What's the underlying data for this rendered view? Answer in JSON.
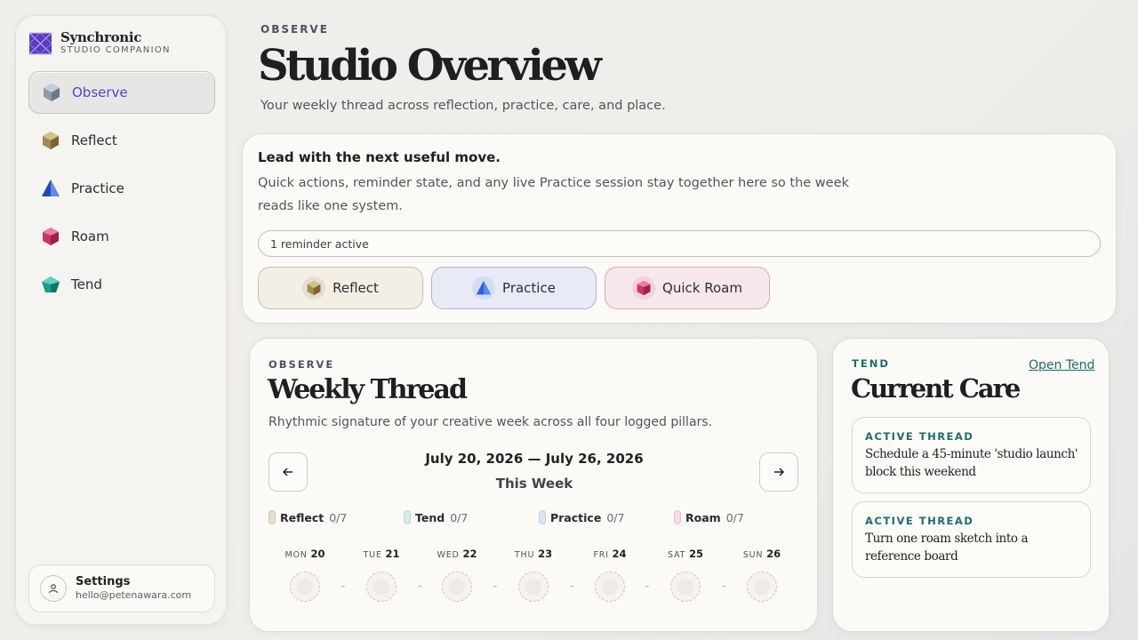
{
  "brand": {
    "name": "Synchronic",
    "subtitle": "STUDIO COMPANION"
  },
  "sidebar": {
    "items": [
      {
        "label": "Observe",
        "icon": "observe-gem-icon",
        "active": true
      },
      {
        "label": "Reflect",
        "icon": "reflect-gem-icon"
      },
      {
        "label": "Practice",
        "icon": "practice-gem-icon"
      },
      {
        "label": "Roam",
        "icon": "roam-gem-icon"
      },
      {
        "label": "Tend",
        "icon": "tend-gem-icon"
      }
    ],
    "settings": {
      "title": "Settings",
      "email": "hello@petenawara.com",
      "icon": "user-icon"
    }
  },
  "header": {
    "eyebrow": "OBSERVE",
    "title": "Studio Overview",
    "subtitle": "Your weekly thread across reflection, practice, care, and place."
  },
  "actions": {
    "title": "Lead with the next useful move.",
    "description": "Quick actions, reminder state, and any live Practice session stay together here so the week reads like one system.",
    "reminder": "1 reminder active",
    "buttons": {
      "reflect": "Reflect",
      "practice": "Practice",
      "roam": "Quick Roam"
    }
  },
  "weekly": {
    "eyebrow": "OBSERVE",
    "title": "Weekly Thread",
    "subtitle": "Rhythmic signature of your creative week across all four logged pillars.",
    "date_range": "July 20, 2026 — July 26, 2026",
    "week_label": "This Week",
    "legend": [
      {
        "name": "Reflect",
        "count": "0/7",
        "color": "#d8cdb8"
      },
      {
        "name": "Tend",
        "count": "0/7",
        "color": "#bfe0dc"
      },
      {
        "name": "Practice",
        "count": "0/7",
        "color": "#c9d2ea"
      },
      {
        "name": "Roam",
        "count": "0/7",
        "color": "#efc4d0"
      }
    ],
    "days": [
      {
        "abbr": "MON",
        "num": "20"
      },
      {
        "abbr": "TUE",
        "num": "21"
      },
      {
        "abbr": "WED",
        "num": "22"
      },
      {
        "abbr": "THU",
        "num": "23"
      },
      {
        "abbr": "FRI",
        "num": "24"
      },
      {
        "abbr": "SAT",
        "num": "25"
      },
      {
        "abbr": "SUN",
        "num": "26"
      }
    ]
  },
  "care": {
    "eyebrow": "TEND",
    "link": "Open Tend",
    "title": "Current Care",
    "threads": [
      {
        "label": "ACTIVE THREAD",
        "text": "Schedule a 45-minute 'studio launch' block this weekend"
      },
      {
        "label": "ACTIVE THREAD",
        "text": "Turn one roam sketch into a reference board"
      }
    ]
  },
  "colors": {
    "accent": "#5940c8",
    "tend": "#1f6d6a",
    "reflect": "#b59a5c",
    "practice": "#3d6fe0",
    "roam": "#d2457a"
  }
}
